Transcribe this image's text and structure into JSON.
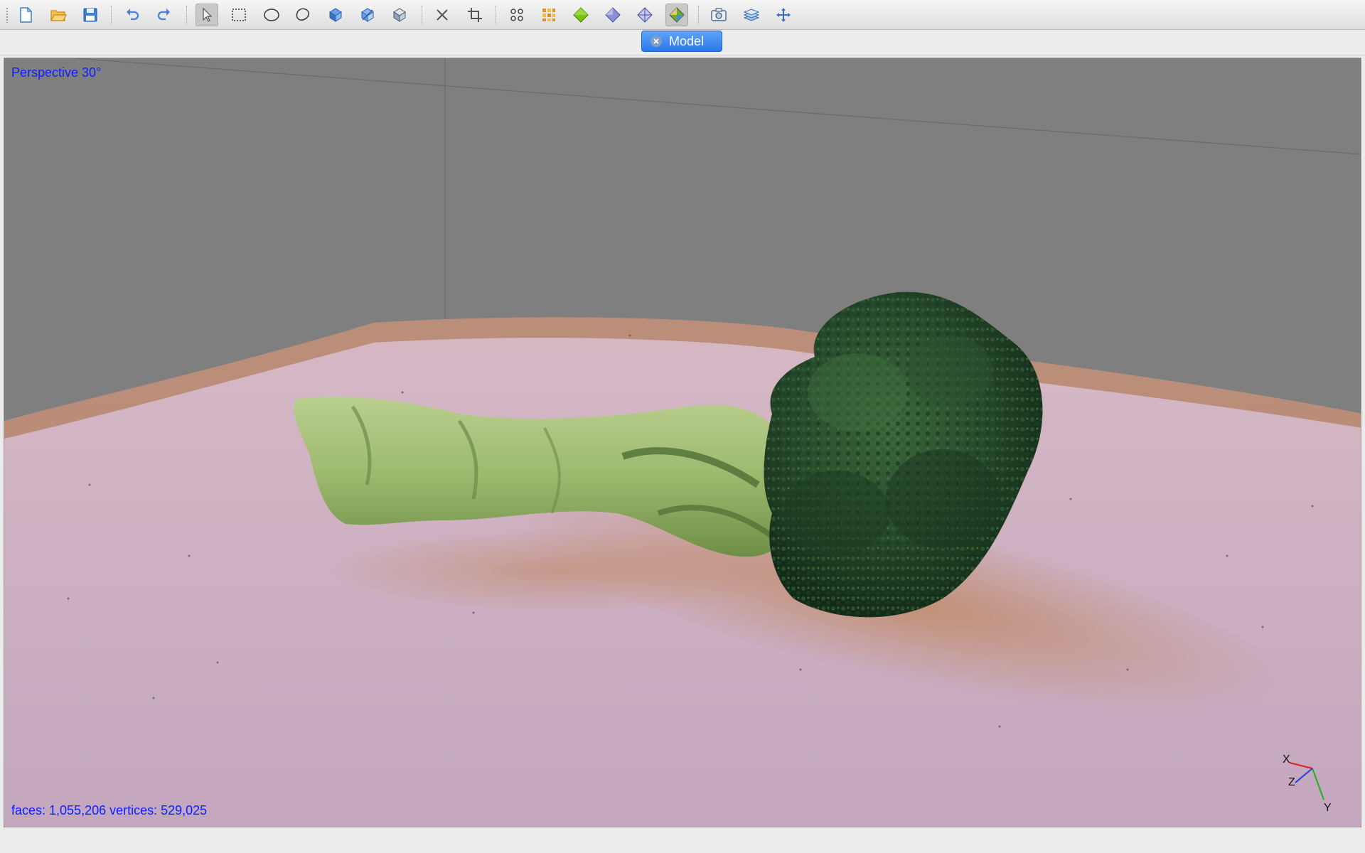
{
  "toolbar": {
    "buttons": [
      {
        "id": "new",
        "icon": "new-file-icon"
      },
      {
        "id": "open",
        "icon": "folder-open-icon"
      },
      {
        "id": "save",
        "icon": "floppy-disk-icon"
      },
      {
        "id": "undo",
        "icon": "undo-icon"
      },
      {
        "id": "redo",
        "icon": "redo-icon"
      },
      {
        "id": "select",
        "icon": "pointer-icon",
        "active": true
      },
      {
        "id": "rect-select",
        "icon": "rectangle-select-icon"
      },
      {
        "id": "ellipse-select",
        "icon": "ellipse-select-icon"
      },
      {
        "id": "lasso-select",
        "icon": "lasso-select-icon"
      },
      {
        "id": "select-through",
        "icon": "select-through-icon"
      },
      {
        "id": "select-invert",
        "icon": "invert-selection-icon"
      },
      {
        "id": "select-connected",
        "icon": "connected-selection-icon"
      },
      {
        "id": "delete",
        "icon": "delete-x-icon"
      },
      {
        "id": "crop",
        "icon": "crop-icon"
      },
      {
        "id": "view-points",
        "icon": "points-grid-icon"
      },
      {
        "id": "view-texture",
        "icon": "texture-grid-icon"
      },
      {
        "id": "shade-green",
        "icon": "green-shaded-icon"
      },
      {
        "id": "shade-solid",
        "icon": "solid-shaded-icon"
      },
      {
        "id": "shade-wire",
        "icon": "wireframe-icon"
      },
      {
        "id": "shade-textured",
        "icon": "textured-shaded-icon",
        "active": true
      },
      {
        "id": "camera",
        "icon": "camera-icon"
      },
      {
        "id": "layers",
        "icon": "layers-icon"
      },
      {
        "id": "navigate",
        "icon": "move-arrows-icon"
      }
    ]
  },
  "tabs": [
    {
      "label": "Model",
      "active": true
    }
  ],
  "viewport": {
    "projection_label": "Perspective 30°",
    "stats_label": "faces: 1,055,206 vertices: 529,025",
    "axis_labels": {
      "x": "X",
      "y": "Y",
      "z": "Z"
    }
  },
  "colors": {
    "overlay_text": "#0b22ff",
    "tab_active": "#3b8af0",
    "viewport_bg": "#7f7f7f",
    "axis_x": "#e02020",
    "axis_y": "#20b020",
    "axis_z": "#2040e0"
  }
}
